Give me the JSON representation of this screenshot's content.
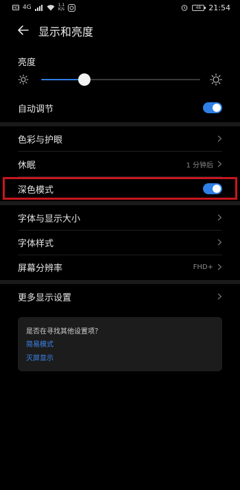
{
  "status_bar": {
    "network": "4G",
    "speed_value": "1.1",
    "speed_unit": "K/s",
    "battery": "48",
    "time": "21:54"
  },
  "header": {
    "title": "显示和亮度"
  },
  "brightness": {
    "label": "亮度",
    "level": 0.27
  },
  "auto_adjust": {
    "label": "自动调节",
    "enabled": true
  },
  "group1": {
    "color_eye": {
      "label": "色彩与护眼"
    },
    "sleep": {
      "label": "休眠",
      "value": "1 分钟后"
    },
    "dark_mode": {
      "label": "深色模式",
      "enabled": true
    }
  },
  "group2": {
    "font_size": {
      "label": "字体与显示大小"
    },
    "font_style": {
      "label": "字体样式"
    },
    "resolution": {
      "label": "屏幕分辨率",
      "value": "FHD+"
    }
  },
  "group3": {
    "more": {
      "label": "更多显示设置"
    }
  },
  "tips": {
    "title": "是否在寻找其他设置项？",
    "link1": "简易模式",
    "link2": "灭屏显示"
  },
  "colors": {
    "accent": "#2f7fe6",
    "highlight": "#c8161e",
    "background": "#000000"
  }
}
